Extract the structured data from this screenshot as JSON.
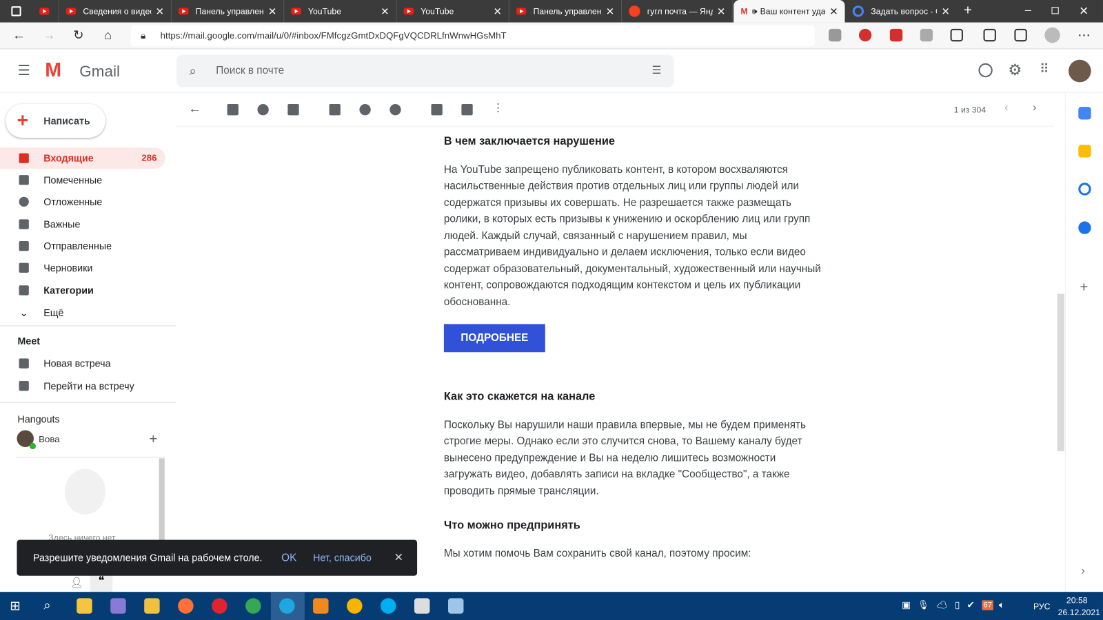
{
  "browser": {
    "tabs": [
      {
        "title": ""
      },
      {
        "title": "Сведения о видео"
      },
      {
        "title": "Панель управления"
      },
      {
        "title": "YouTube"
      },
      {
        "title": "YouTube"
      },
      {
        "title": "Панель управления"
      },
      {
        "title": "гугл почта — Яндекс"
      },
      {
        "title": "Ваш контент удалён",
        "active": true
      },
      {
        "title": "Задать вопрос - Google"
      }
    ],
    "url": "https://mail.google.com/mail/u/0/#inbox/FMfcgzGmtDxDQFgVQCDRLfnWnwHGsMhT"
  },
  "gmail": {
    "logo": "Gmail",
    "search_placeholder": "Поиск в почте",
    "compose": "Написать",
    "nav": [
      {
        "label": "Входящие",
        "count": "286",
        "active": true
      },
      {
        "label": "Помеченные"
      },
      {
        "label": "Отложенные"
      },
      {
        "label": "Важные"
      },
      {
        "label": "Отправленные"
      },
      {
        "label": "Черновики"
      },
      {
        "label": "Категории"
      },
      {
        "label": "Ещё"
      }
    ],
    "meet": {
      "title": "Meet",
      "items": [
        "Новая встреча",
        "Перейти на встречу"
      ]
    },
    "hangouts": {
      "title": "Hangouts",
      "user": "Вова",
      "empty": "Здесь ничего нет"
    },
    "pager": "1 из 304"
  },
  "email": {
    "h1": "В чем заключается нарушение",
    "p1": "На YouTube запрещено публиковать контент, в котором восхваляются насильственные действия против отдельных лиц или группы людей или содержатся призывы их совершать. Не разрешается также размещать ролики, в которых есть призывы к унижению и оскорблению лиц или групп людей. Каждый случай, связанный с нарушением правил, мы рассматриваем индивидуально и делаем исключения, только если видео содержат образовательный, документальный, художественный или научный контент, сопровождаются подходящим контекстом и цель их публикации обоснованна.",
    "button": "ПОДРОБНЕЕ",
    "h2": "Как это скажется на канале",
    "p2": "Поскольку Вы нарушили наши правила впервые, мы не будем применять строгие меры. Однако если это случится снова, то Вашему каналу будет вынесено предупреждение и Вы на неделю лишитесь возможности загружать видео, добавлять записи на вкладке \"Сообщество\", а также проводить прямые трансляции.",
    "h3": "Что можно предпринять",
    "p3": "Мы хотим помочь Вам сохранить свой канал, поэтому просим:"
  },
  "snackbar": {
    "text": "Разрешите уведомления Gmail на рабочем столе.",
    "ok": "OK",
    "no": "Нет, спасибо"
  },
  "taskbar": {
    "time": "20:58",
    "date": "26.12.2021",
    "lang": "РУС",
    "battery_badge": "67"
  },
  "colors": {
    "accent": "#3151d8",
    "inbox": "#d93025",
    "taskbar": "#063c74"
  }
}
